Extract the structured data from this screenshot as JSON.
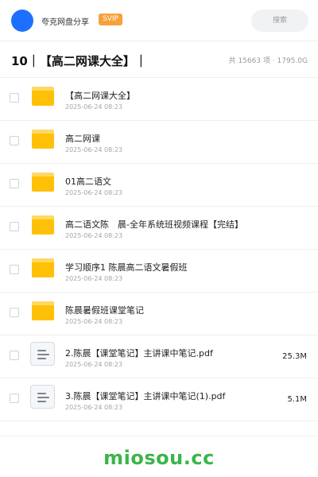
{
  "header": {
    "owner_name": "夸克网盘分享",
    "badge": "SVIP",
    "search_placeholder": "搜索",
    "avatar_color": "#1e6fff",
    "badge_color": "#f7a13a"
  },
  "folder": {
    "title": "10｜【高二网课大全】｜",
    "stats": "共 15663 项 · 1795.0G"
  },
  "files": [
    {
      "name": "【高二网课大全】",
      "date": "2025-06-24 08:23",
      "type": "folder",
      "size": ""
    },
    {
      "name": "高二网课",
      "date": "2025-06-24 08:23",
      "type": "folder",
      "size": ""
    },
    {
      "name": "01高二语文",
      "date": "2025-06-24 08:23",
      "type": "folder",
      "size": ""
    },
    {
      "name": "高二语文陈　晨-全年系统班视频课程【完结】",
      "date": "2025-06-24 08:23",
      "type": "folder",
      "size": ""
    },
    {
      "name": "学习顺序1 陈晨高二语文暑假班",
      "date": "2025-06-24 08:23",
      "type": "folder",
      "size": ""
    },
    {
      "name": "陈晨暑假班课堂笔记",
      "date": "2025-06-24 08:23",
      "type": "folder",
      "size": ""
    },
    {
      "name": "2.陈晨【课堂笔记】主讲课中笔记.pdf",
      "date": "2025-06-24 08:23",
      "type": "document",
      "size": "25.3M"
    },
    {
      "name": "3.陈晨【课堂笔记】主讲课中笔记(1).pdf",
      "date": "2025-06-24 08:23",
      "type": "document",
      "size": "5.1M"
    }
  ],
  "icons": {
    "folder": "folder-icon",
    "document": "document-icon",
    "folder_color": "#ffc107"
  },
  "watermark": {
    "text": "miosou.cc",
    "color": "#3bb54a"
  }
}
